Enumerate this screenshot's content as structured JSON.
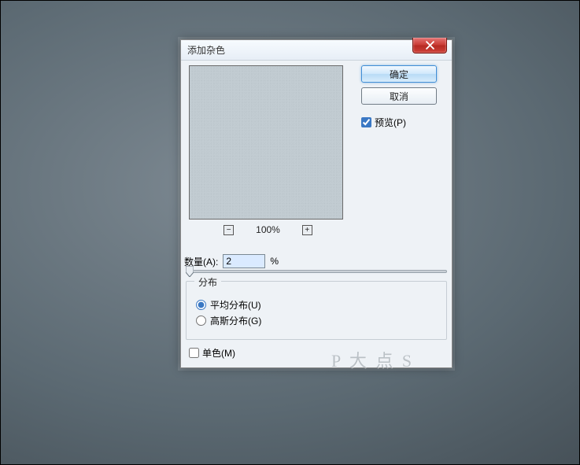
{
  "dialog": {
    "title": "添加杂色",
    "ok": "确定",
    "cancel": "取消",
    "preview_label": "预览(P)",
    "preview_checked": true,
    "zoom_pct": "100%",
    "amount_label": "数量(A):",
    "amount_value": "2",
    "amount_unit": "%",
    "distribution_legend": "分布",
    "dist_uniform": "平均分布(U)",
    "dist_gaussian": "高斯分布(G)",
    "dist_selected": "uniform",
    "mono_label": "单色(M)",
    "mono_checked": false
  },
  "watermark": "P 大 点 S",
  "icons": {
    "zoom_out": "−",
    "zoom_in": "+"
  }
}
